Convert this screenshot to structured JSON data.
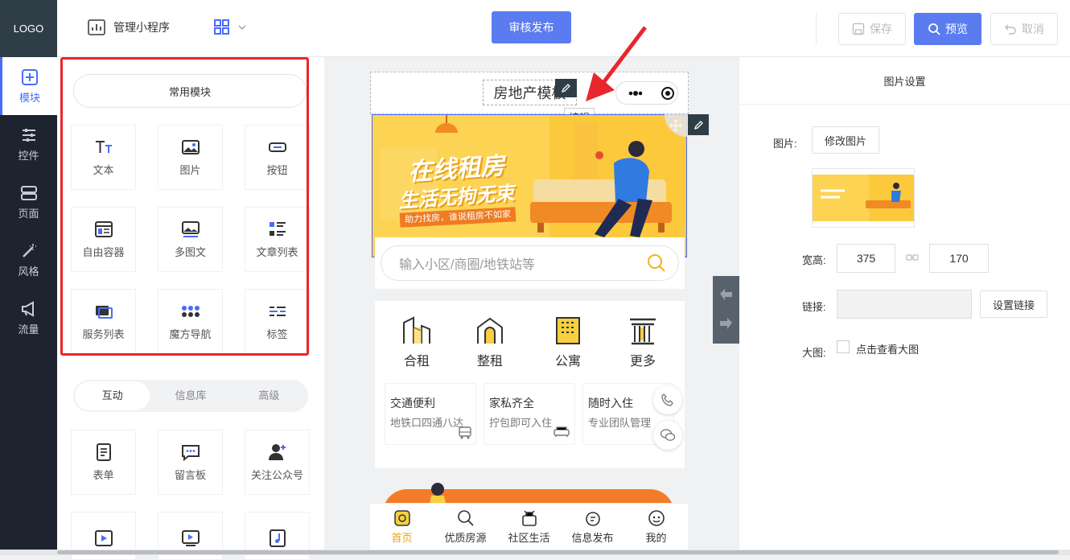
{
  "logo": "LOGO",
  "leftnav": [
    {
      "label": "模块",
      "icon": "plus-square-icon",
      "active": true
    },
    {
      "label": "控件",
      "icon": "sliders-icon"
    },
    {
      "label": "页面",
      "icon": "pages-icon"
    },
    {
      "label": "风格",
      "icon": "magic-wand-icon"
    },
    {
      "label": "流量",
      "icon": "megaphone-icon"
    }
  ],
  "topbar": {
    "manage_label": "管理小程序",
    "publish_label": "审核发布",
    "save_label": "保存",
    "preview_label": "预览",
    "cancel_label": "取消"
  },
  "panel": {
    "common_title": "常用模块",
    "common_modules": [
      {
        "label": "文本",
        "icon": "text-icon"
      },
      {
        "label": "图片",
        "icon": "image-icon"
      },
      {
        "label": "按钮",
        "icon": "button-icon"
      },
      {
        "label": "自由容器",
        "icon": "container-icon"
      },
      {
        "label": "多图文",
        "icon": "multi-image-text-icon"
      },
      {
        "label": "文章列表",
        "icon": "article-list-icon"
      },
      {
        "label": "服务列表",
        "icon": "service-list-icon"
      },
      {
        "label": "魔方导航",
        "icon": "cube-nav-icon"
      },
      {
        "label": "标签",
        "icon": "tag-icon"
      }
    ],
    "segments": [
      "互动",
      "信息库",
      "高级"
    ],
    "active_segment": "互动",
    "interact_modules": [
      {
        "label": "表单",
        "icon": "form-icon"
      },
      {
        "label": "留言板",
        "icon": "message-board-icon"
      },
      {
        "label": "关注公众号",
        "icon": "follow-account-icon"
      }
    ]
  },
  "phone": {
    "title": "房地产模板",
    "edit_tooltip": "编辑",
    "banner": {
      "headline1": "在线租房",
      "headline2": "生活无拘无束",
      "tagline": "助力找房，谁说租房不如家"
    },
    "search_placeholder": "输入小区/商圈/地铁站等",
    "categories": [
      {
        "label": "合租",
        "icon": "building-share-icon"
      },
      {
        "label": "整租",
        "icon": "house-icon"
      },
      {
        "label": "公寓",
        "icon": "apartment-icon"
      },
      {
        "label": "更多",
        "icon": "more-columns-icon"
      }
    ],
    "cards": [
      {
        "title": "交通便利",
        "sub": "地铁口四通八达",
        "icon": "bus-icon"
      },
      {
        "title": "家私齐全",
        "sub": "拧包即可入住",
        "icon": "sofa-icon"
      },
      {
        "title": "随时入住",
        "sub": "专业团队管理",
        "icon": "door-icon"
      }
    ],
    "tabbar": [
      {
        "label": "首页",
        "icon": "home-icon",
        "active": true
      },
      {
        "label": "优质房源",
        "icon": "search-icon"
      },
      {
        "label": "社区生活",
        "icon": "community-icon"
      },
      {
        "label": "信息发布",
        "icon": "publish-icon"
      },
      {
        "label": "我的",
        "icon": "user-face-icon"
      }
    ]
  },
  "settings": {
    "title": "图片设置",
    "image_label": "图片:",
    "change_image": "修改图片",
    "size_label": "宽高:",
    "width": "375",
    "height": "170",
    "link_label": "链接:",
    "link_value": "",
    "set_link": "设置链接",
    "big_label": "大图:",
    "big_checkbox_label": "点击查看大图",
    "big_checked": false
  },
  "colors": {
    "accent": "#5b7cf0",
    "nav_bg": "#1d232f",
    "highlight_red": "#e8262b",
    "banner_yellow": "#fdd354",
    "tab_active": "#e8a21c"
  }
}
